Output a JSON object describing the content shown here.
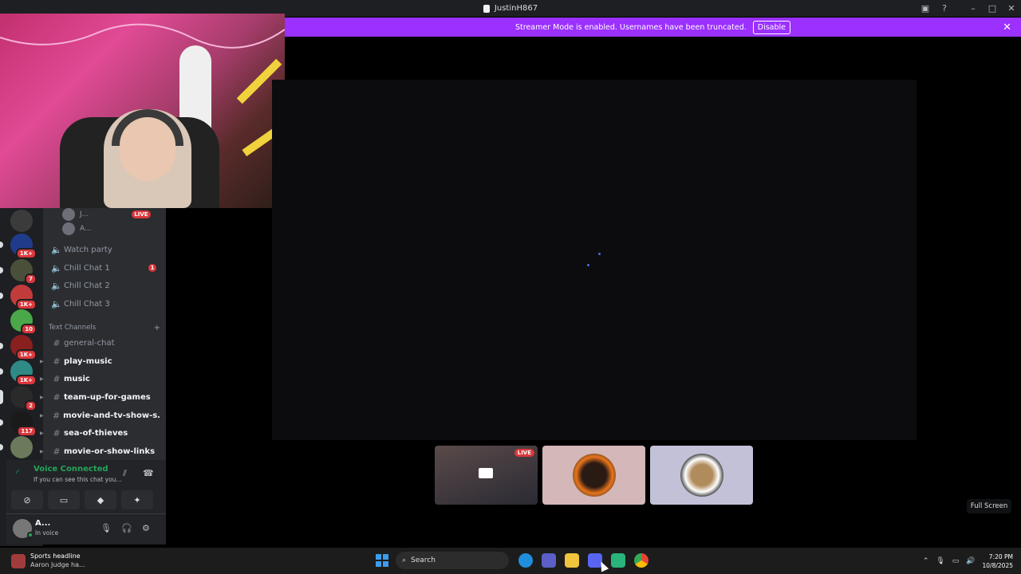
{
  "window": {
    "title": "JustinH867"
  },
  "banner": {
    "text": "Streamer Mode is enabled. Usernames have been truncated.",
    "disable_label": "Disable"
  },
  "servers": [
    {
      "badge": ""
    },
    {
      "badge": "1K+"
    },
    {
      "badge": "7"
    },
    {
      "badge": "1K+"
    },
    {
      "badge": "10"
    },
    {
      "badge": "1K+"
    },
    {
      "badge": "1K+"
    },
    {
      "badge": "2"
    },
    {
      "badge": "117"
    },
    {
      "badge": ""
    }
  ],
  "voice_users": [
    {
      "name": "J...",
      "live_label": "LIVE"
    },
    {
      "name": "A..."
    }
  ],
  "voice_channels": [
    {
      "name": "Watch party",
      "count": ""
    },
    {
      "name": "Chill Chat 1",
      "count": "1"
    },
    {
      "name": "Chill Chat 2",
      "count": ""
    },
    {
      "name": "Chill Chat 3",
      "count": ""
    }
  ],
  "text_section": {
    "label": "Text Channels",
    "add": "+"
  },
  "text_channels": [
    {
      "name": "general-chat"
    },
    {
      "name": "play-music"
    },
    {
      "name": "music"
    },
    {
      "name": "team-up-for-games"
    },
    {
      "name": "movie-and-tv-show-s..."
    },
    {
      "name": "sea-of-thieves"
    },
    {
      "name": "movie-or-show-links"
    }
  ],
  "voice_panel": {
    "title": "Voice Connected",
    "subtitle": "If you can see this chat you..."
  },
  "user_panel": {
    "name": "A...",
    "status": "In voice"
  },
  "tiles": {
    "live_label": "LIVE"
  },
  "fullscreen_label": "Full Screen",
  "taskbar": {
    "news_title": "Sports headline",
    "news_sub": "Aaron Judge ha...",
    "search_label": "Search",
    "time": "7:20 PM",
    "date": "10/8/2025"
  },
  "colors": {
    "brand": "#5865f2",
    "banner": "#9b30ff",
    "online": "#23a55a",
    "live": "#da373c"
  }
}
